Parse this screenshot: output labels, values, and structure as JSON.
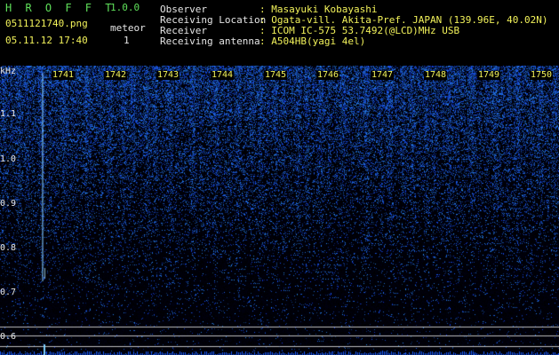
{
  "app": {
    "name": "H R O F F T",
    "version": "1.0.0"
  },
  "file": {
    "name": "0511121740.png",
    "timestamp": "05.11.12 17:40"
  },
  "meteor": {
    "label": "meteor",
    "count": "1"
  },
  "info": [
    {
      "key": "Observer",
      "value": ": Masayuki Kobayashi"
    },
    {
      "key": "Receiving Location",
      "value": ": Ogata-vill. Akita-Pref. JAPAN (139.96E, 40.02N)"
    },
    {
      "key": "Receiver",
      "value": ": ICOM IC-575 53.7492(@LCD)MHz USB"
    },
    {
      "key": "Receiving antenna",
      "value": ": A504HB(yagi 4el)"
    }
  ],
  "y_axis": {
    "unit": "kHz",
    "ticks": [
      "1.1",
      "1.0",
      "0.9",
      "0.8",
      "0.7",
      "0.6"
    ]
  },
  "x_axis": {
    "ticks": [
      "1741",
      "1742",
      "1743",
      "1744",
      "1745",
      "1746",
      "1747",
      "1748",
      "1749",
      "1750"
    ]
  },
  "colors": {
    "header_green": "#5fe05a",
    "header_yellow": "#f2f25a",
    "signal_blue": "#2a5cff"
  }
}
